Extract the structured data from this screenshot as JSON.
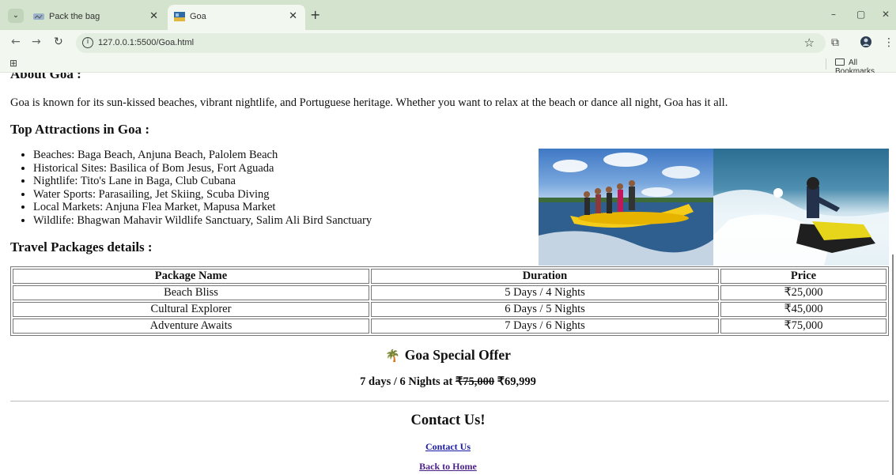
{
  "browser": {
    "tabs": [
      {
        "title": "Pack the bag",
        "active": false
      },
      {
        "title": "Goa",
        "active": true
      }
    ],
    "new_tab": "+",
    "window_controls": {
      "minimize": "–",
      "maximize": "▢",
      "close": "✕"
    },
    "url": "127.0.0.1:5500/Goa.html",
    "bookmarks_label": "All Bookmarks",
    "icons": [
      "chevron-down-icon",
      "close-icon",
      "back-arrow-icon",
      "forward-arrow-icon",
      "reload-icon",
      "site-info-icon",
      "star-icon",
      "extensions-icon",
      "profile-icon",
      "more-menu-icon",
      "apps-grid-icon",
      "folder-icon"
    ]
  },
  "page": {
    "about_heading": "About Goa :",
    "about_text": "Goa is known for its sun-kissed beaches, vibrant nightlife, and Portuguese heritage. Whether you want to relax at the beach or dance all night, Goa has it all.",
    "attractions_heading": "Top Attractions in Goa :",
    "attractions": [
      "Beaches: Baga Beach, Anjuna Beach, Palolem Beach",
      "Historical Sites: Basilica of Bom Jesus, Fort Aguada",
      "Nightlife: Tito's Lane in Baga, Club Cubana",
      "Water Sports: Parasailing, Jet Skiing, Scuba Diving",
      "Local Markets: Anjuna Flea Market, Mapusa Market",
      "Wildlife: Bhagwan Mahavir Wildlife Sanctuary, Salim Ali Bird Sanctuary"
    ],
    "packages_heading": "Travel Packages details :",
    "table": {
      "headers": [
        "Package Name",
        "Duration",
        "Price"
      ],
      "rows": [
        [
          "Beach Bliss",
          "5 Days / 4 Nights",
          "₹25,000"
        ],
        [
          "Cultural Explorer",
          "6 Days / 5 Nights",
          "₹45,000"
        ],
        [
          "Adventure Awaits",
          "7 Days / 6 Nights",
          "₹75,000"
        ]
      ]
    },
    "offer": {
      "icon": "palm-tree-icon",
      "title": "Goa Special Offer",
      "prefix": "7 days / 6 Nights at",
      "old_price": "₹75,000",
      "new_price": "₹69,999"
    },
    "contact_heading": "Contact Us!",
    "links": {
      "contact": "Contact Us",
      "home": "Back to Home"
    }
  }
}
